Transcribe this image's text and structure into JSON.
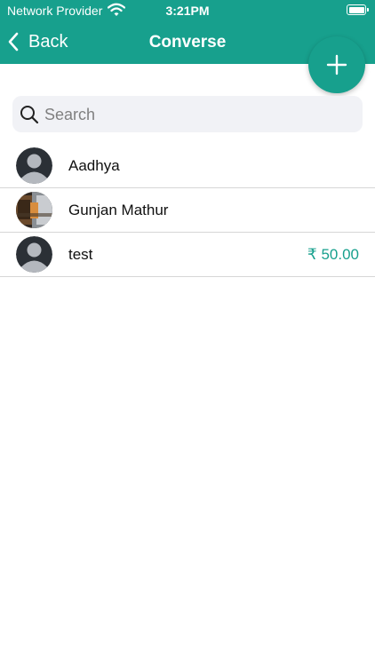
{
  "status_bar": {
    "carrier": "Network Provider",
    "time": "3:21PM"
  },
  "nav": {
    "back_label": "Back",
    "title": "Converse"
  },
  "fab": {
    "icon": "plus-icon"
  },
  "search": {
    "placeholder": "Search",
    "value": ""
  },
  "contacts": [
    {
      "name": "Aadhya",
      "amount": "",
      "avatar": "default-avatar"
    },
    {
      "name": "Gunjan Mathur",
      "amount": "",
      "avatar": "photo-avatar"
    },
    {
      "name": "test",
      "amount": "₹ 50.00",
      "avatar": "default-avatar"
    }
  ],
  "colors": {
    "brand": "#17a08d",
    "search_bg": "#f1f2f6",
    "divider": "#d6d6d6"
  }
}
